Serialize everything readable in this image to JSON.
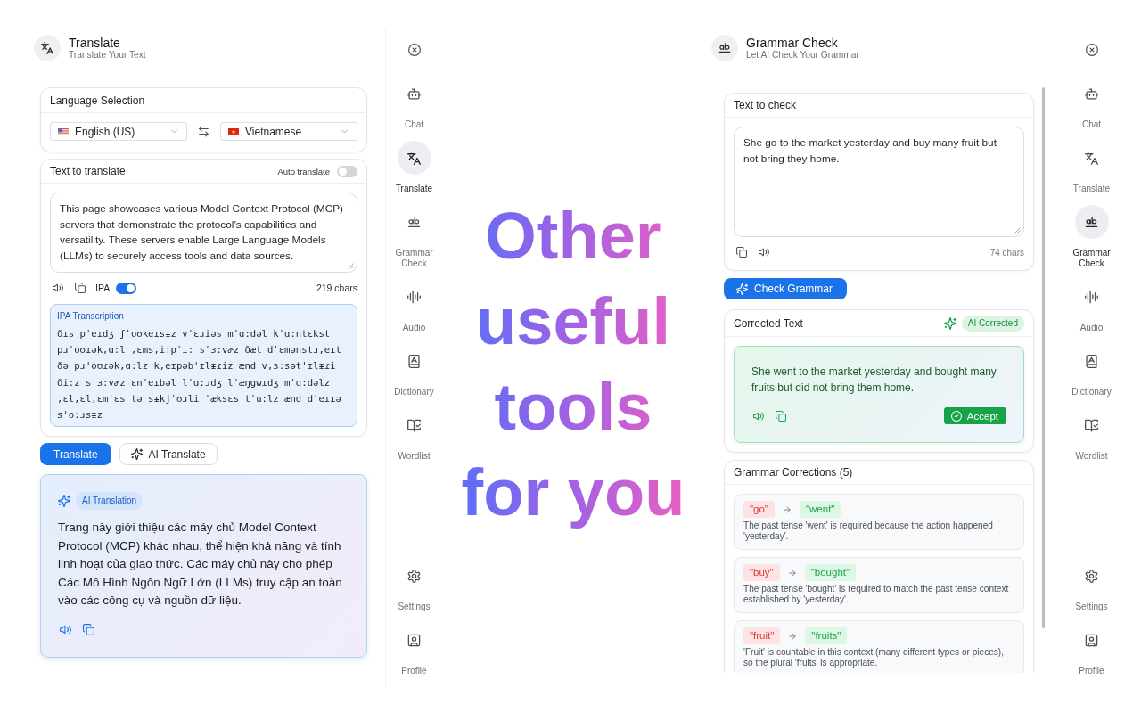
{
  "translate_app": {
    "header": {
      "title": "Translate",
      "subtitle": "Translate Your Text"
    },
    "language_card": {
      "title": "Language Selection",
      "source_language": "English (US)",
      "target_language": "Vietnamese"
    },
    "input_card": {
      "title": "Text to translate",
      "auto_translate": {
        "label": "Auto translate",
        "on": false
      },
      "text": "This page showcases various Model Context Protocol (MCP) servers that demonstrate the protocol’s capabilities and versatility. These servers enable Large Language Models (LLMs) to securely access tools and data sources.",
      "ipa_toggle": {
        "label": "IPA",
        "on": true
      },
      "char_count": "219 chars",
      "ipa": {
        "title": "IPA Transcription",
        "text": "ðɪs p'eɪdʒ ʃ'oʊkeɪsᵻz v'ɛɹiəs m'ɑ:dəl k'ɑ:ntɛkst pɹ'oʊɾək,ɑ:l ,ɛms,i:p'i: s'ɜ:vɚz ðæt d'ɛmənstɹ,eɪt ðə pɹ'oʊɾək,ɑ:lz k,eɪpəb'ɪlᵻɾiz ænd v,ɜ:sət'ɪlᵻɾi ði:z s'ɜ:vɚz ɛn'eɪbəl l'ɑ:ɹdʒ l'æŋgwɪdʒ m'ɑ:dəlz ,ɛl,ɛl,ɛm'ɛs tə sᵻkj'ʊɹli 'æksɛs t'u:lz ænd d'eɪɾə s'o:ɹsᵻz"
      }
    },
    "buttons": [
      {
        "kind": "primary",
        "label": "Translate"
      },
      {
        "kind": "ai",
        "label": "AI Translate"
      }
    ],
    "result": {
      "badge": "AI Translation",
      "text": "Trang này giới thiệu các máy chủ Model Context Protocol (MCP) khác nhau, thể hiện khả năng và tính linh hoạt của giao thức. Các máy chủ này cho phép Các Mô Hình Ngôn Ngữ Lớn (LLMs) truy cập an toàn vào các công cụ và nguồn dữ liệu."
    },
    "sidebar": {
      "items": [
        {
          "label": "Chat",
          "selected": false
        },
        {
          "label": "Translate",
          "selected": true
        },
        {
          "label": "Grammar Check",
          "selected": false
        },
        {
          "label": "Audio",
          "selected": false
        },
        {
          "label": "Dictionary",
          "selected": false
        },
        {
          "label": "Wordlist",
          "selected": false
        }
      ],
      "bottom_items": [
        {
          "label": "Settings",
          "selected": false
        },
        {
          "label": "Profile",
          "selected": false
        }
      ]
    }
  },
  "headline": {
    "lines": [
      "Other",
      "useful",
      "tools",
      "for you"
    ]
  },
  "grammar_app": {
    "header": {
      "title": "Grammar Check",
      "subtitle": "Let AI Check Your Grammar"
    },
    "input_card": {
      "title": "Text to check",
      "text": "She go to the market yesterday and buy many fruit but not bring they home.",
      "char_count": "74 chars"
    },
    "check_button": {
      "label": "Check Grammar"
    },
    "corrected_card": {
      "title": "Corrected Text",
      "badge": "AI Corrected",
      "text": "She went to the market yesterday and bought many fruits but did not bring them home.",
      "accept_button": {
        "label": "Accept"
      }
    },
    "corrections_card": {
      "title": "Grammar Corrections (5)",
      "items": [
        {
          "original": "\"go\"",
          "suggestion": "\"went\"",
          "explanation": "The past tense 'went' is required because the action happened 'yesterday'."
        },
        {
          "original": "\"buy\"",
          "suggestion": "\"bought\"",
          "explanation": "The past tense 'bought' is required to match the past tense context established by 'yesterday'."
        },
        {
          "original": "\"fruit\"",
          "suggestion": "\"fruits\"",
          "explanation": "'Fruit' is countable in this context (many different types or pieces), so the plural 'fruits' is appropriate."
        }
      ]
    },
    "sidebar": {
      "items": [
        {
          "label": "Chat",
          "selected": false
        },
        {
          "label": "Translate",
          "selected": false
        },
        {
          "label": "Grammar Check",
          "selected": true
        },
        {
          "label": "Audio",
          "selected": false
        },
        {
          "label": "Dictionary",
          "selected": false
        },
        {
          "label": "Wordlist",
          "selected": false
        }
      ],
      "bottom_items": [
        {
          "label": "Settings",
          "selected": false
        },
        {
          "label": "Profile",
          "selected": false
        }
      ]
    }
  }
}
